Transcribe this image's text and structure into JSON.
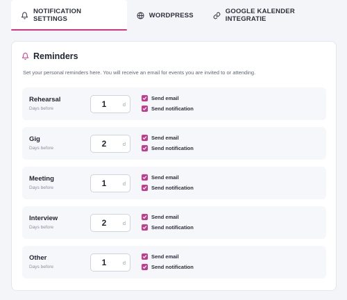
{
  "tabs": [
    {
      "label": "NOTIFICATION SETTINGS",
      "icon": "bell-icon",
      "active": true
    },
    {
      "label": "WORDPRESS",
      "icon": "globe-icon",
      "active": false
    },
    {
      "label": "GOOGLE KALENDER INTEGRATIE",
      "icon": "link-icon",
      "active": false
    }
  ],
  "reminders": {
    "title": "Reminders",
    "icon": "bell-icon",
    "description": "Set your personal reminders here. You will receive an email for events you are invited to or attending.",
    "rows": [
      {
        "name": "Rehearsal",
        "sub": "Days before",
        "value": "1",
        "unit": "d",
        "email_label": "Send email",
        "notification_label": "Send notification",
        "email_checked": true,
        "notification_checked": true
      },
      {
        "name": "Gig",
        "sub": "Days before",
        "value": "2",
        "unit": "d",
        "email_label": "Send email",
        "notification_label": "Send notification",
        "email_checked": true,
        "notification_checked": true
      },
      {
        "name": "Meeting",
        "sub": "Days before",
        "value": "1",
        "unit": "d",
        "email_label": "Send email",
        "notification_label": "Send notification",
        "email_checked": true,
        "notification_checked": true
      },
      {
        "name": "Interview",
        "sub": "Days before",
        "value": "2",
        "unit": "d",
        "email_label": "Send email",
        "notification_label": "Send notification",
        "email_checked": true,
        "notification_checked": true
      },
      {
        "name": "Other",
        "sub": "Days before",
        "value": "1",
        "unit": "d",
        "email_label": "Send email",
        "notification_label": "Send notification",
        "email_checked": true,
        "notification_checked": true
      }
    ]
  },
  "colors": {
    "accent": "#d63384",
    "checkbox": "#c43a8d"
  }
}
